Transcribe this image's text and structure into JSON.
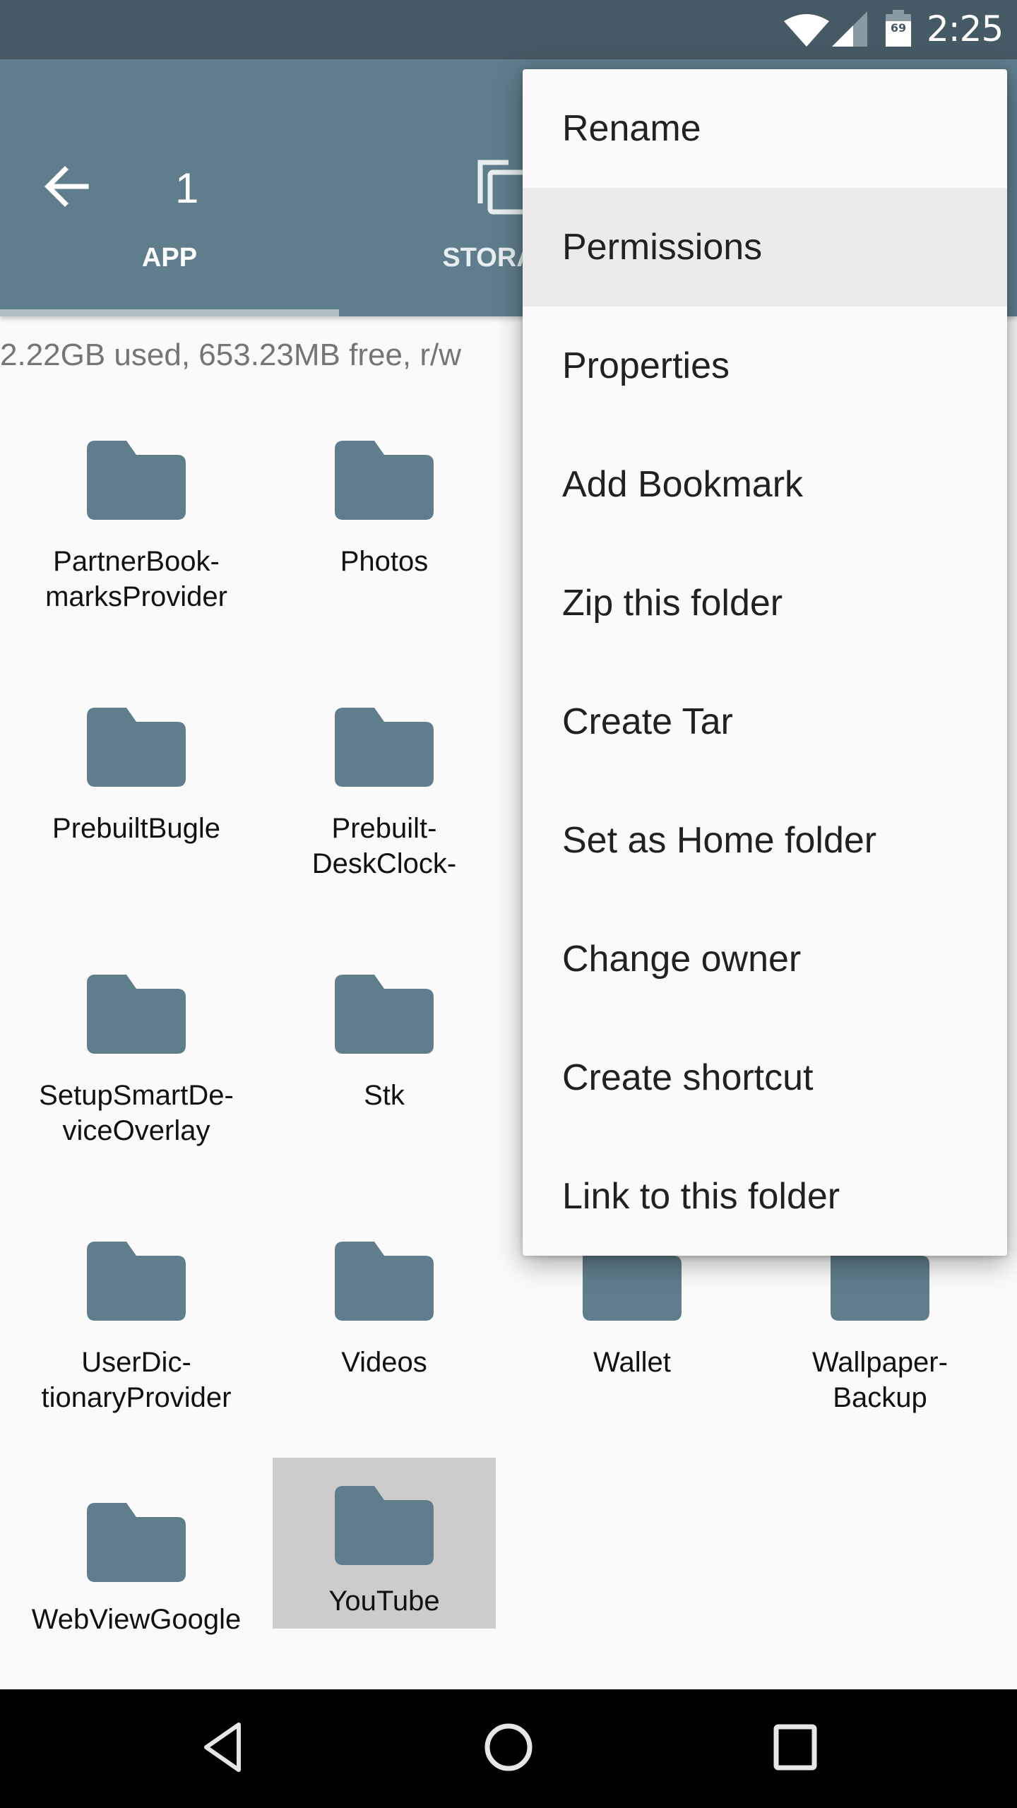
{
  "status_bar": {
    "battery_percent": "69",
    "time": "2:25",
    "icons": [
      "wifi-icon",
      "cell-signal-icon",
      "battery-icon"
    ]
  },
  "app_bar": {
    "back_icon": "arrow-left-icon",
    "title": "1",
    "action_icon": "copy-icon"
  },
  "tabs": [
    {
      "label": "APP",
      "active": true
    },
    {
      "label": "STORAGE",
      "active": false
    }
  ],
  "storage_info": "2.22GB used, 653.23MB free, r/w",
  "folders": [
    {
      "name": "PartnerBook-\nmarksProvider",
      "selected": false
    },
    {
      "name": "Photos",
      "selected": false
    },
    {
      "name": "PrebuiltBugle",
      "selected": false
    },
    {
      "name": "Prebuilt-\nDeskClock-",
      "selected": false
    },
    {
      "name": "SetupSmartDe-\nviceOverlay",
      "selected": false
    },
    {
      "name": "Stk",
      "selected": false
    },
    {
      "name": "UserDic-\ntionaryProvider",
      "selected": false
    },
    {
      "name": "Videos",
      "selected": false
    },
    {
      "name": "Wallet",
      "selected": false
    },
    {
      "name": "Wallpaper-\nBackup",
      "selected": false
    },
    {
      "name": "WebViewGoogle",
      "selected": false
    },
    {
      "name": "YouTube",
      "selected": true
    }
  ],
  "menu": {
    "items": [
      {
        "label": "Rename",
        "highlighted": false
      },
      {
        "label": "Permissions",
        "highlighted": true
      },
      {
        "label": "Properties",
        "highlighted": false
      },
      {
        "label": "Add Bookmark",
        "highlighted": false
      },
      {
        "label": "Zip this folder",
        "highlighted": false
      },
      {
        "label": "Create Tar",
        "highlighted": false
      },
      {
        "label": "Set as Home folder",
        "highlighted": false
      },
      {
        "label": "Change owner",
        "highlighted": false
      },
      {
        "label": "Create shortcut",
        "highlighted": false
      },
      {
        "label": "Link to this folder",
        "highlighted": false
      }
    ]
  },
  "nav_bar": {
    "icons": [
      "nav-back-icon",
      "nav-home-icon",
      "nav-recents-icon"
    ]
  },
  "colors": {
    "primary": "#607d8b",
    "primary_dark": "#455a64",
    "folder": "#607d8b",
    "selected_bg": "#cccccc",
    "menu_highlight": "#ebebeb"
  }
}
